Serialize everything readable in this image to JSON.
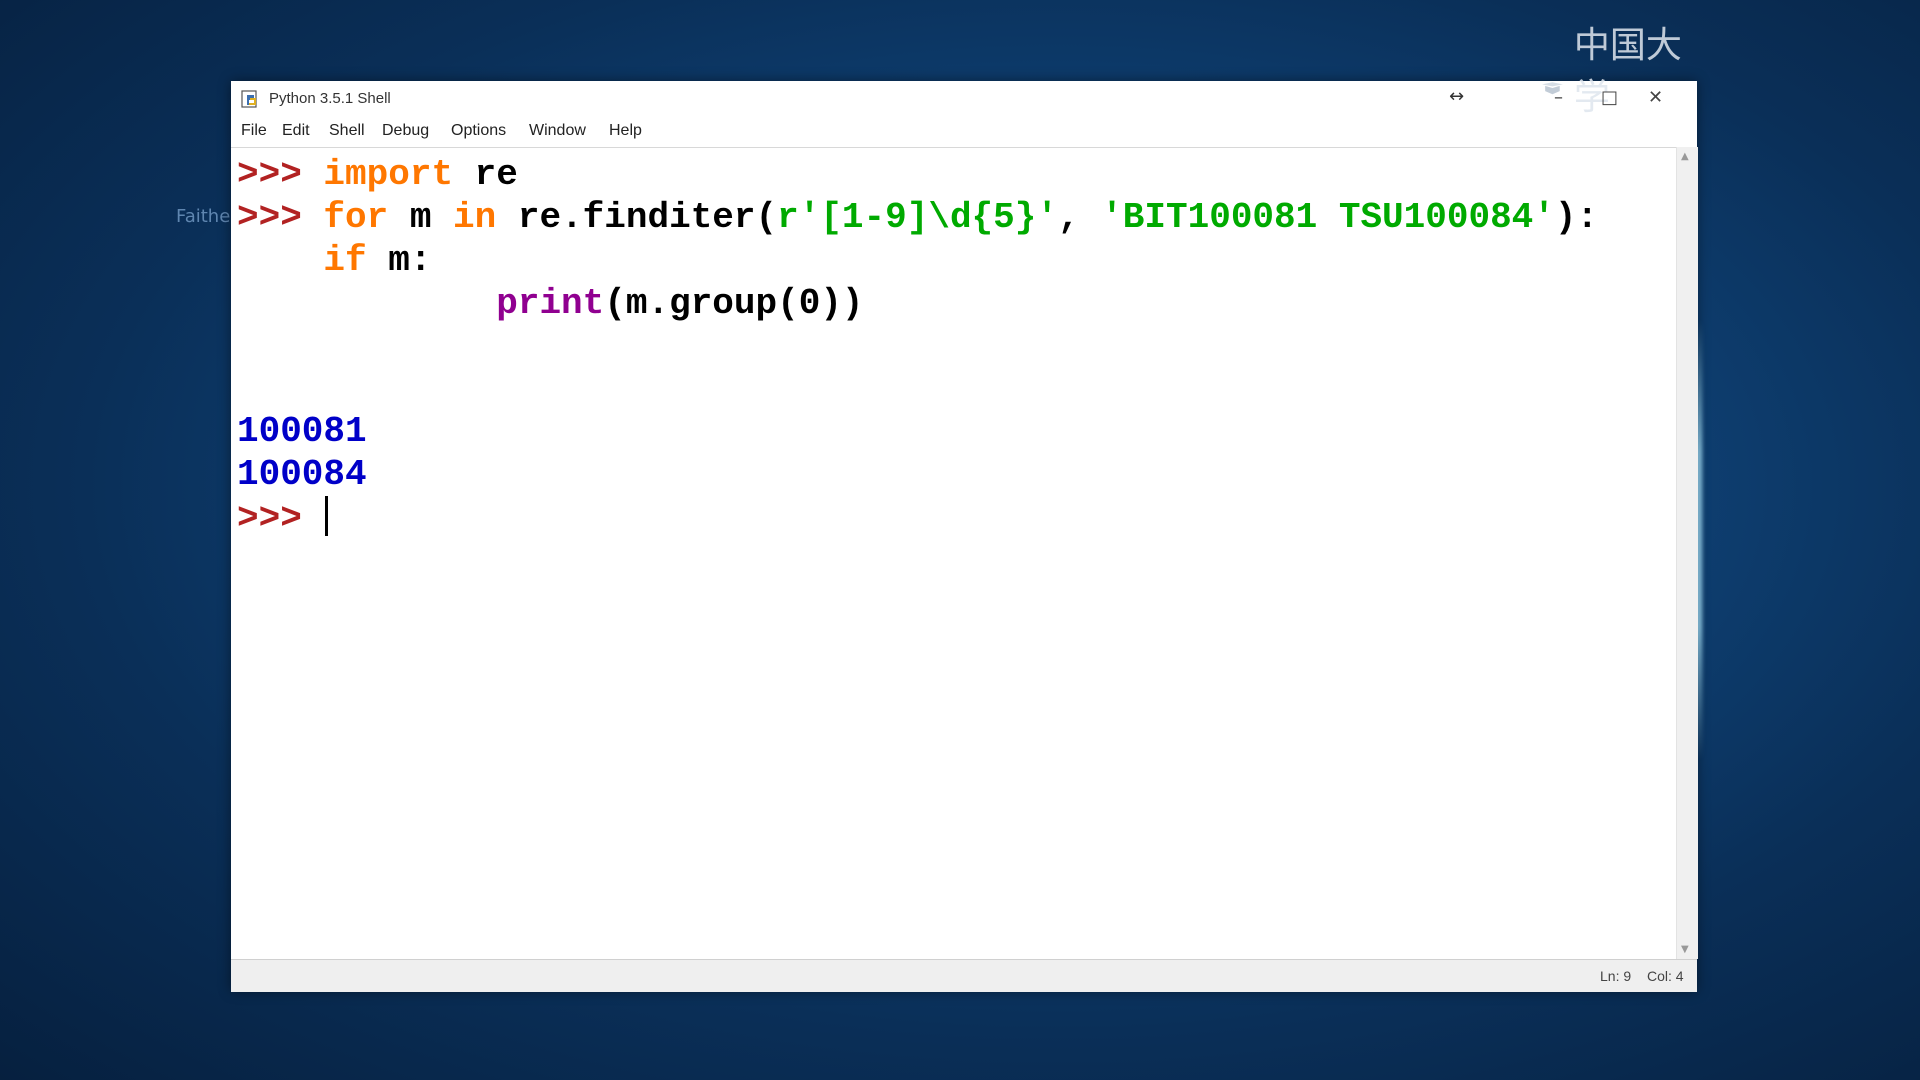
{
  "desktop": {
    "label": "Faithe"
  },
  "window": {
    "title": "Python 3.5.1 Shell",
    "resize_glyph": "↔",
    "watermark": "中国大学MOOC",
    "minimize_glyph": "–",
    "maximize_glyph": "□",
    "close_glyph": "✕"
  },
  "menu": {
    "items": [
      {
        "label": "File"
      },
      {
        "label": "Edit"
      },
      {
        "label": "Shell"
      },
      {
        "label": "Debug"
      },
      {
        "label": "Options"
      },
      {
        "label": "Window"
      },
      {
        "label": "Help"
      }
    ]
  },
  "shell": {
    "line1": {
      "prompt": ">>> ",
      "kw_import": "import",
      "rest": " re"
    },
    "line2": {
      "prompt": ">>> ",
      "kw_for": "for",
      "m": " m ",
      "kw_in": "in",
      "call": " re.finditer(",
      "pattern": "r'[1-9]\\d{5}'",
      "comma": ", ",
      "text": "'BIT100081 TSU100084'",
      "close": "):"
    },
    "line3": {
      "indent": "    ",
      "kw_if": "if",
      "rest": " m:"
    },
    "line4": {
      "indent": "            ",
      "builtin_print": "print",
      "rest": "(m.group(0))"
    },
    "output": [
      "100081",
      "100084"
    ],
    "final_prompt": ">>> "
  },
  "status": {
    "ln": "Ln: 9",
    "col": "Col: 4"
  },
  "colors": {
    "prompt": "#b22222",
    "keyword": "#ff7700",
    "string": "#00aa00",
    "builtin": "#900090",
    "output": "#0000c8"
  }
}
